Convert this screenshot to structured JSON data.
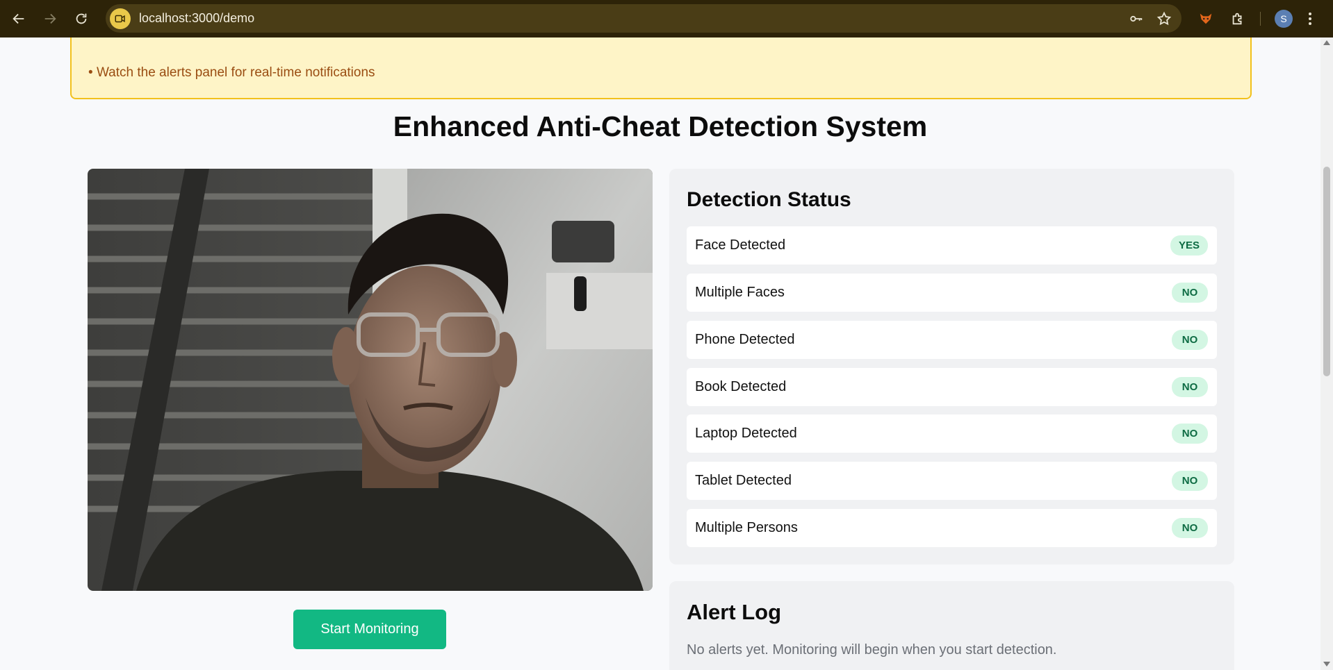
{
  "browser": {
    "url": "localhost:3000/demo",
    "profile_initial": "S",
    "icons": [
      "back-icon",
      "forward-icon",
      "reload-icon",
      "site-info-icon",
      "password-key-icon",
      "bookmark-star-icon",
      "extension-fox-icon",
      "extensions-puzzle-icon"
    ]
  },
  "tips": {
    "last_tip": "Watch the alerts panel for real-time notifications"
  },
  "page": {
    "title": "Enhanced Anti-Cheat Detection System"
  },
  "controls": {
    "start_label": "Start Monitoring"
  },
  "status": {
    "heading": "Detection Status",
    "items": [
      {
        "label": "Face Detected",
        "value": "YES"
      },
      {
        "label": "Multiple Faces",
        "value": "NO"
      },
      {
        "label": "Phone Detected",
        "value": "NO"
      },
      {
        "label": "Book Detected",
        "value": "NO"
      },
      {
        "label": "Laptop Detected",
        "value": "NO"
      },
      {
        "label": "Tablet Detected",
        "value": "NO"
      },
      {
        "label": "Multiple Persons",
        "value": "NO"
      }
    ]
  },
  "alerts": {
    "heading": "Alert Log",
    "empty_message": "No alerts yet. Monitoring will begin when you start detection."
  },
  "colors": {
    "accent": "#12b883",
    "badge_bg": "#d3f6e3",
    "badge_text": "#0d6b43",
    "tips_bg": "#fef4c7",
    "tips_border": "#f2c11c",
    "chrome_bg": "#2d2308"
  }
}
